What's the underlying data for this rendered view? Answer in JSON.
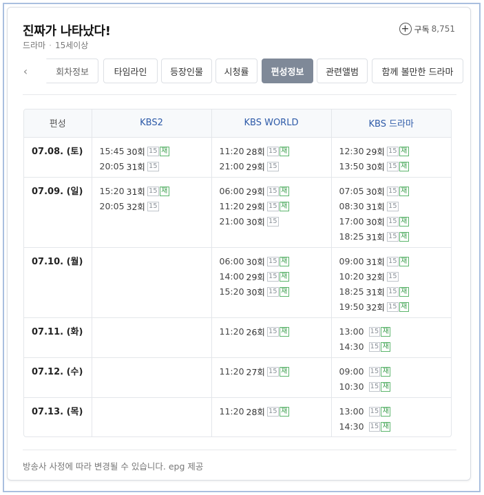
{
  "header": {
    "title": "진짜가 나타났다!",
    "genre": "드라마",
    "rating": "15세이상",
    "subscribe_label": "구독",
    "subscribe_count": "8,751"
  },
  "tabs": [
    {
      "label": "회차정보",
      "active": false
    },
    {
      "label": "타임라인",
      "active": false
    },
    {
      "label": "등장인물",
      "active": false
    },
    {
      "label": "시청률",
      "active": false
    },
    {
      "label": "편성정보",
      "active": true
    },
    {
      "label": "관련앨범",
      "active": false
    },
    {
      "label": "함께 볼만한 드라마",
      "active": false
    }
  ],
  "schedule": {
    "header_label": "편성",
    "channels": [
      "KBS2",
      "KBS WORLD",
      "KBS 드라마"
    ],
    "rows": [
      {
        "date": "07.08. (토)",
        "cells": [
          [
            {
              "time": "15:45",
              "ep": "30회",
              "age": "15",
              "re": "재"
            },
            {
              "time": "20:05",
              "ep": "31회",
              "age": "15",
              "re": ""
            }
          ],
          [
            {
              "time": "11:20",
              "ep": "28회",
              "age": "15",
              "re": "재"
            },
            {
              "time": "21:00",
              "ep": "29회",
              "age": "15",
              "re": ""
            }
          ],
          [
            {
              "time": "12:30",
              "ep": "29회",
              "age": "15",
              "re": "재"
            },
            {
              "time": "13:50",
              "ep": "30회",
              "age": "15",
              "re": "재"
            }
          ]
        ]
      },
      {
        "date": "07.09. (일)",
        "cells": [
          [
            {
              "time": "15:20",
              "ep": "31회",
              "age": "15",
              "re": "재"
            },
            {
              "time": "20:05",
              "ep": "32회",
              "age": "15",
              "re": ""
            }
          ],
          [
            {
              "time": "06:00",
              "ep": "29회",
              "age": "15",
              "re": "재"
            },
            {
              "time": "11:20",
              "ep": "29회",
              "age": "15",
              "re": "재"
            },
            {
              "time": "21:00",
              "ep": "30회",
              "age": "15",
              "re": ""
            }
          ],
          [
            {
              "time": "07:05",
              "ep": "30회",
              "age": "15",
              "re": "재"
            },
            {
              "time": "08:30",
              "ep": "31회",
              "age": "15",
              "re": ""
            },
            {
              "time": "17:00",
              "ep": "30회",
              "age": "15",
              "re": "재"
            },
            {
              "time": "18:25",
              "ep": "31회",
              "age": "15",
              "re": "재"
            }
          ]
        ]
      },
      {
        "date": "07.10. (월)",
        "cells": [
          [],
          [
            {
              "time": "06:00",
              "ep": "30회",
              "age": "15",
              "re": "재"
            },
            {
              "time": "14:00",
              "ep": "29회",
              "age": "15",
              "re": "재"
            },
            {
              "time": "15:20",
              "ep": "30회",
              "age": "15",
              "re": "재"
            }
          ],
          [
            {
              "time": "09:00",
              "ep": "31회",
              "age": "15",
              "re": "재"
            },
            {
              "time": "10:20",
              "ep": "32회",
              "age": "15",
              "re": ""
            },
            {
              "time": "18:25",
              "ep": "31회",
              "age": "15",
              "re": "재"
            },
            {
              "time": "19:50",
              "ep": "32회",
              "age": "15",
              "re": "재"
            }
          ]
        ]
      },
      {
        "date": "07.11. (화)",
        "cells": [
          [],
          [
            {
              "time": "11:20",
              "ep": "26회",
              "age": "15",
              "re": "재"
            }
          ],
          [
            {
              "time": "13:00",
              "ep": "",
              "age": "15",
              "re": "재"
            },
            {
              "time": "14:30",
              "ep": "",
              "age": "15",
              "re": "재"
            }
          ]
        ]
      },
      {
        "date": "07.12. (수)",
        "cells": [
          [],
          [
            {
              "time": "11:20",
              "ep": "27회",
              "age": "15",
              "re": "재"
            }
          ],
          [
            {
              "time": "09:00",
              "ep": "",
              "age": "15",
              "re": "재"
            },
            {
              "time": "10:30",
              "ep": "",
              "age": "15",
              "re": "재"
            }
          ]
        ]
      },
      {
        "date": "07.13. (목)",
        "cells": [
          [],
          [
            {
              "time": "11:20",
              "ep": "28회",
              "age": "15",
              "re": "재"
            }
          ],
          [
            {
              "time": "13:00",
              "ep": "",
              "age": "15",
              "re": "재"
            },
            {
              "time": "14:30",
              "ep": "",
              "age": "15",
              "re": "재"
            }
          ]
        ]
      }
    ]
  },
  "footnote": "방송사 사정에 따라 변경될 수 있습니다. epg 제공"
}
